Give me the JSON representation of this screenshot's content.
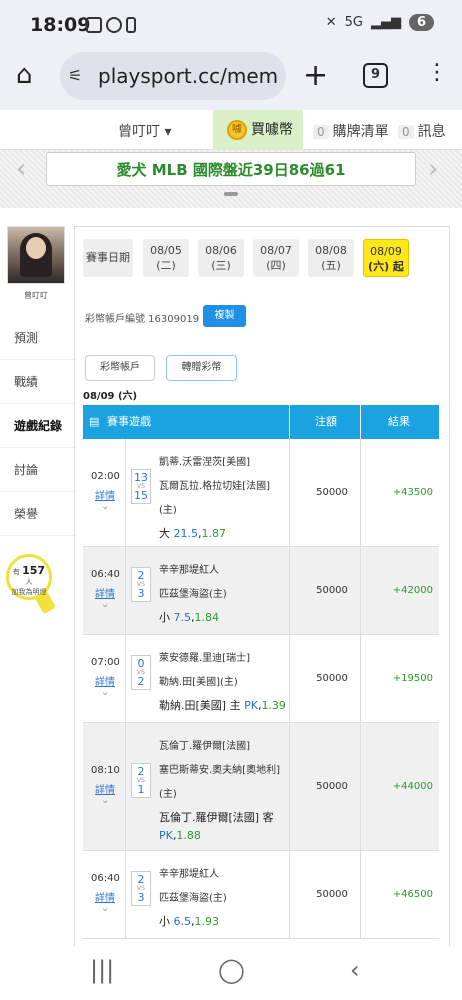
{
  "status_bar": {
    "time": "18:09",
    "network": "5G",
    "battery": "6"
  },
  "browser": {
    "url": "playsport.cc/membe",
    "tab_count": "9"
  },
  "site_nav": {
    "user": "曾叮叮 ▾",
    "buy_label": "買噱幣",
    "coin_icon_text": "噱",
    "cart_count": "0",
    "cart_label": "購牌清單",
    "msg_count": "0",
    "msg_label": "訊息"
  },
  "banner": {
    "text": "愛犬 MLB 國際盤近39日86過61"
  },
  "sidebar": {
    "username": "曾叮叮",
    "items": [
      {
        "label": "預測"
      },
      {
        "label": "戰績"
      },
      {
        "label": "遊戲紀錄"
      },
      {
        "label": "討論"
      },
      {
        "label": "榮譽"
      }
    ],
    "bulb_prefix": "有",
    "bulb_count": "157",
    "bulb_suffix": "人",
    "bulb_text": "加我為明燈"
  },
  "dates": {
    "label": "賽事日期",
    "items": [
      {
        "date": "08/05",
        "day": "(二)"
      },
      {
        "date": "08/06",
        "day": "(三)"
      },
      {
        "date": "08/07",
        "day": "(四)"
      },
      {
        "date": "08/08",
        "day": "(五)"
      },
      {
        "date": "08/09",
        "day": "(六) 起"
      }
    ]
  },
  "account": {
    "label": "彩幣帳戶編號 16309019",
    "copy": "複製",
    "tab1": "彩幣帳戶",
    "tab2": "轉贈彩幣"
  },
  "date_header": "08/09 (六)",
  "table": {
    "headers": {
      "game": "賽事遊戲",
      "bet": "注額",
      "result": "結果"
    },
    "detail_label": "詳情",
    "vs_label": "VS",
    "rows": [
      {
        "time": "02:00",
        "s1": "13",
        "s2": "15",
        "team1": "凱蒂.沃雷涅茨[美國]",
        "team2": "瓦爾瓦拉.格拉切娃[法國]",
        "team3": "(主)",
        "bet_pre": "大",
        "bet_line": "21.5",
        "bet_odds": "1.87",
        "amount": "50000",
        "result": "+43500"
      },
      {
        "time": "06:40",
        "s1": "2",
        "s2": "3",
        "team1": "辛辛那堤紅人",
        "team2": "匹茲堡海盜(主)",
        "team3": "",
        "bet_pre": "小",
        "bet_line": "7.5",
        "bet_odds": "1.84",
        "amount": "50000",
        "result": "+42000"
      },
      {
        "time": "07:00",
        "s1": "0",
        "s2": "2",
        "team1": "萊安德羅.里迪[瑞士]",
        "team2": "勒納.田[美國](主)",
        "team3": "",
        "bet_pre": "勒納.田[美國] 主",
        "bet_line": "PK",
        "bet_odds": "1.39",
        "amount": "50000",
        "result": "+19500"
      },
      {
        "time": "08:10",
        "s1": "2",
        "s2": "1",
        "team1": "瓦倫丁.羅伊爾[法國]",
        "team2": "塞巴斯蒂安.奧夫納[奧地利]",
        "team3": "(主)",
        "bet_pre": "瓦倫丁.羅伊爾[法國] 客",
        "bet_line": "PK",
        "bet_odds": "1.88",
        "amount": "50000",
        "result": "+44000"
      },
      {
        "time": "06:40",
        "s1": "2",
        "s2": "3",
        "team1": "辛辛那堤紅人",
        "team2": "匹茲堡海盜(主)",
        "team3": "",
        "bet_pre": "小",
        "bet_line": "6.5",
        "bet_odds": "1.93",
        "amount": "50000",
        "result": "+46500"
      }
    ]
  }
}
